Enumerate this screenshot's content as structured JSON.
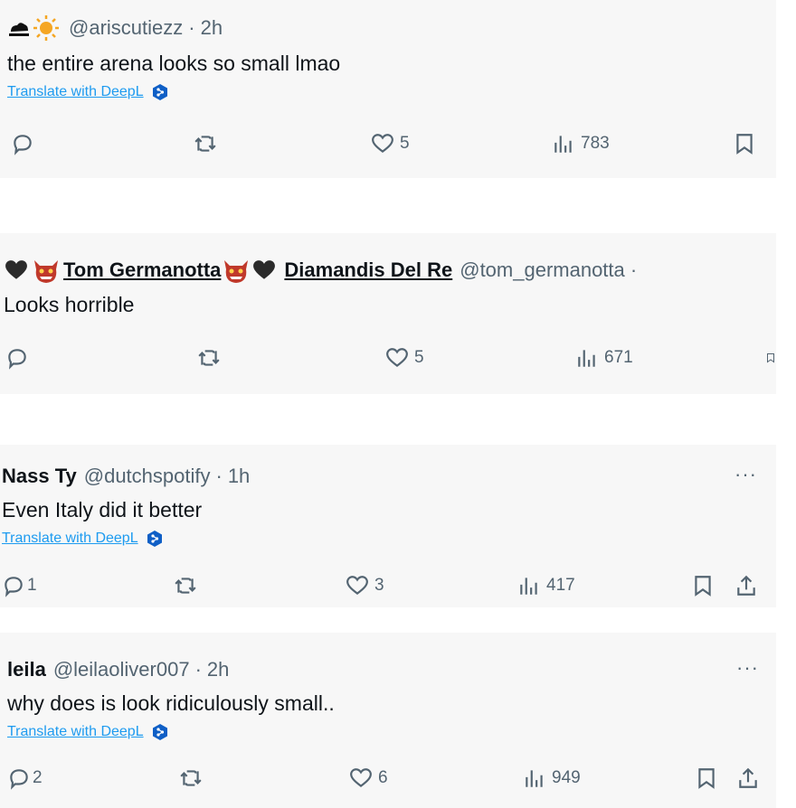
{
  "tweets": [
    {
      "prefix_icons": [
        "cloud-icon",
        "sun-icon"
      ],
      "handle": "@ariscutiezz",
      "sep": "·",
      "time": "2h",
      "text": "the entire arena looks so small lmao",
      "translate": "Translate with DeepL",
      "likes": "5",
      "views": "783"
    },
    {
      "display_name_1": "Tom Germanotta",
      "display_name_2": "Diamandis Del Re",
      "handle": "@tom_germanotta · ",
      "text": "Looks horrible",
      "likes": "5",
      "views": "671"
    },
    {
      "name": "Nass Ty",
      "handle": "@dutchspotify",
      "sep": "·",
      "time": "1h",
      "text": "Even Italy did it better",
      "translate": "Translate with DeepL",
      "replies": "1",
      "likes": "3",
      "views": "417",
      "more": "···"
    },
    {
      "name": "leila",
      "handle": "@leilaoliver007",
      "sep": "·",
      "time": "2h",
      "text": "why does is look ridiculously small..",
      "translate": "Translate with DeepL",
      "replies": "2",
      "likes": "6",
      "views": "949",
      "more": "···"
    }
  ],
  "colors": {
    "accent": "#1d9bf0",
    "muted": "#536471",
    "card_bg": "#f7f7f7",
    "demon": "#c0392b"
  }
}
